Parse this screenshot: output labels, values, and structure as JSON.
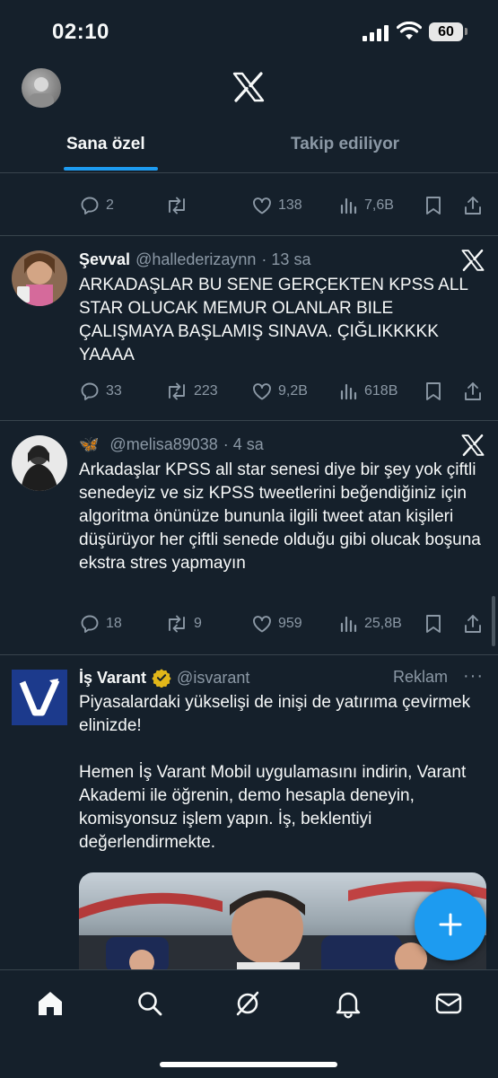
{
  "status_bar": {
    "time": "02:10",
    "battery": "60"
  },
  "tabs": [
    {
      "label": "Sana özel",
      "active": true
    },
    {
      "label": "Takip ediliyor",
      "active": false
    }
  ],
  "prev_tweet": {
    "replies": "2",
    "reposts": "",
    "likes": "138",
    "views": "7,6B"
  },
  "tweets": [
    {
      "name": "Şevval",
      "handle": "@hallederizaynn",
      "time": "· 13 sa",
      "text": "ARKADAŞLAR BU SENE GERÇEKTEN KPSS ALL STAR OLUCAK MEMUR OLANLAR BILE ÇALIŞMAYA BAŞLAMIŞ SINAVA. ÇIĞLIKKKKK YAAAA",
      "replies": "33",
      "reposts": "223",
      "likes": "9,2B",
      "views": "618B"
    },
    {
      "name": "🦋",
      "handle": "@melisa89038",
      "time": "· 4 sa",
      "text": "Arkadaşlar KPSS all star senesi diye bir şey yok çiftli senedeyiz ve siz KPSS tweetlerini beğendiğiniz için algoritma önünüze bununla ilgili tweet atan kişileri düşürüyor her çiftli senede olduğu gibi olucak boşuna ekstra stres yapmayın",
      "replies": "18",
      "reposts": "9",
      "likes": "959",
      "views": "25,8B"
    }
  ],
  "ad": {
    "name": "İş Varant",
    "handle": "@isvarant",
    "label": "Reklam",
    "more": "···",
    "logo_letter": "V",
    "text": "Piyasalardaki yükselişi de inişi de yatırıma çevirmek elinizde!\n\nHemen İş Varant Mobil uygulamasını indirin, Varant Akademi ile öğrenin, demo hesapla deneyin, komisyonsuz işlem yapın. İş, beklentiyi değerlendirmekte."
  },
  "colors": {
    "background": "#15202b",
    "accent": "#1d9bf0",
    "muted": "#8b98a5",
    "verified": "#e2b719"
  },
  "icons": [
    "x-logo-icon",
    "reply-icon",
    "repost-icon",
    "like-icon",
    "views-icon",
    "bookmark-icon",
    "share-icon",
    "home-icon",
    "search-icon",
    "grok-icon",
    "bell-icon",
    "mail-icon",
    "plus-icon",
    "verified-badge-icon"
  ]
}
